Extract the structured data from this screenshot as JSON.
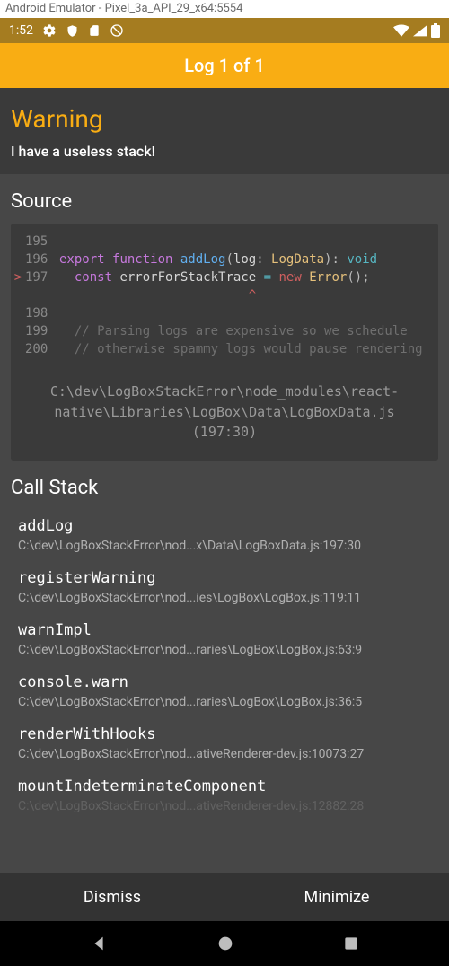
{
  "window_title": "Android Emulator - Pixel_3a_API_29_x64:5554",
  "status": {
    "time": "1:52"
  },
  "header": {
    "title": "Log 1 of 1"
  },
  "warning": {
    "title": "Warning",
    "message": "I have a useless stack!"
  },
  "source": {
    "title": "Source",
    "path": "C:\\dev\\LogBoxStackError\\node_modules\\react-native\\Libraries\\LogBox\\Data\\LogBoxData.js (197:30)",
    "lines": {
      "l195": "195",
      "l196": "196",
      "l197": "197",
      "l198": "198",
      "l199": "199",
      "l200": "200",
      "mark": ">",
      "caret": "                         ^",
      "c196_export": "export ",
      "c196_function": "function ",
      "c196_fn": "addLog",
      "c196_p1": "(",
      "c196_arg": "log",
      "c196_colon": ": ",
      "c196_type": "LogData",
      "c196_p2": ")",
      "c196_colon2": ": ",
      "c196_ret": "void",
      "c197_indent": "  ",
      "c197_const": "const ",
      "c197_var": "errorForStackTrace",
      "c197_sp1": " ",
      "c197_eq": "=",
      "c197_sp2": " ",
      "c197_new": "new ",
      "c197_err": "Error",
      "c197_paren": "();",
      "c199": "  // Parsing logs are expensive so we schedule",
      "c200": "  // otherwise spammy logs would pause rendering"
    }
  },
  "callstack": {
    "title": "Call Stack",
    "items": [
      {
        "fn": "addLog",
        "path": "C:\\dev\\LogBoxStackError\\nod...x\\Data\\LogBoxData.js:197:30"
      },
      {
        "fn": "registerWarning",
        "path": "C:\\dev\\LogBoxStackError\\nod...ies\\LogBox\\LogBox.js:119:11"
      },
      {
        "fn": "warnImpl",
        "path": "C:\\dev\\LogBoxStackError\\nod...raries\\LogBox\\LogBox.js:63:9"
      },
      {
        "fn": "console.warn",
        "path": "C:\\dev\\LogBoxStackError\\nod...raries\\LogBox\\LogBox.js:36:5"
      },
      {
        "fn": "renderWithHooks",
        "path": "C:\\dev\\LogBoxStackError\\nod...ativeRenderer-dev.js:10073:27"
      },
      {
        "fn": "mountIndeterminateComponent",
        "path": "C:\\dev\\LogBoxStackError\\nod...ativeRenderer-dev.js:12882:28"
      }
    ]
  },
  "footer": {
    "dismiss": "Dismiss",
    "minimize": "Minimize"
  }
}
